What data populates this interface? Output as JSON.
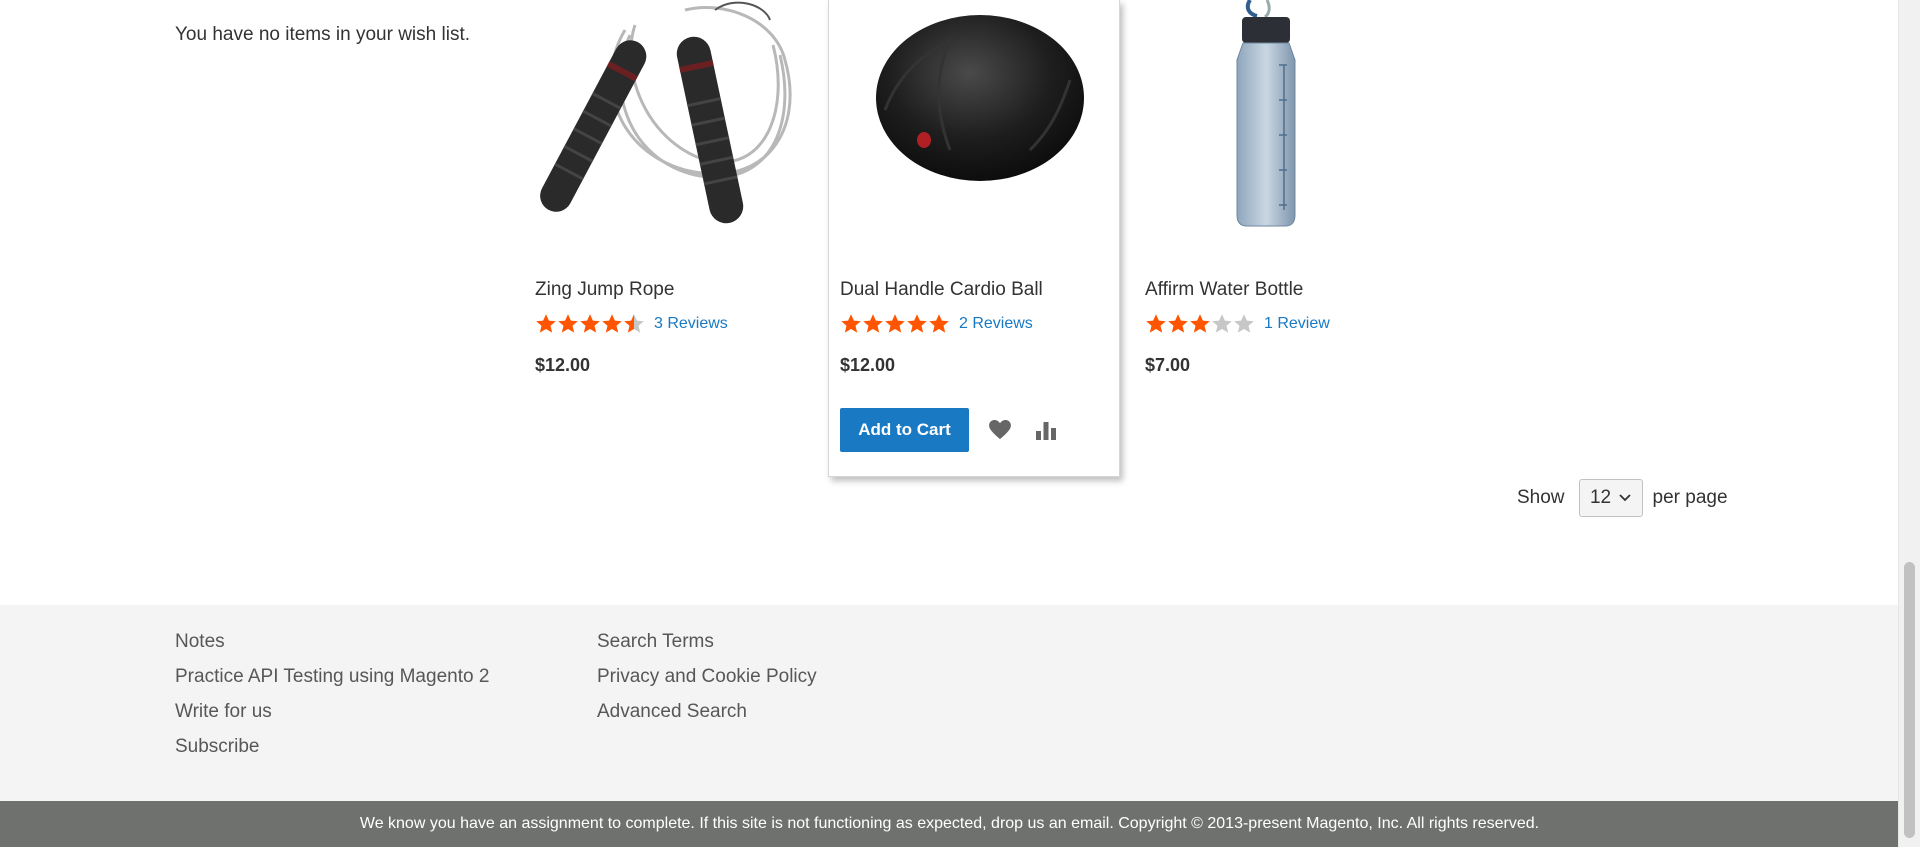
{
  "sidebar": {
    "wishlist_message": "You have no items in your wish list."
  },
  "products": [
    {
      "name": "Zing Jump Rope",
      "rating_percent": 90,
      "reviews": "3 Reviews",
      "price": "$12.00"
    },
    {
      "name": "Dual Handle Cardio Ball",
      "rating_percent": 100,
      "reviews": "2 Reviews",
      "price": "$12.00",
      "add_to_cart_label": "Add to Cart"
    },
    {
      "name": "Affirm Water Bottle",
      "rating_percent": 60,
      "reviews": "1 Review",
      "price": "$7.00"
    }
  ],
  "toolbar": {
    "show_label": "Show",
    "limit_value": "12",
    "per_page_label": "per page"
  },
  "footer": {
    "col1": [
      "Notes",
      "Practice API Testing using Magento 2",
      "Write for us",
      "Subscribe"
    ],
    "col2": [
      "Search Terms",
      "Privacy and Cookie Policy",
      "Advanced Search"
    ]
  },
  "copyright": "We know you have an assignment to complete. If this site is not functioning as expected, drop us an email. Copyright © 2013-present Magento, Inc. All rights reserved.",
  "colors": {
    "star": "#ff5501",
    "star_empty": "#c7c7c7",
    "link": "#1979c3",
    "button": "#1979c3",
    "footer_bg": "#f4f4f4",
    "copyright_bg": "#6e716e"
  }
}
